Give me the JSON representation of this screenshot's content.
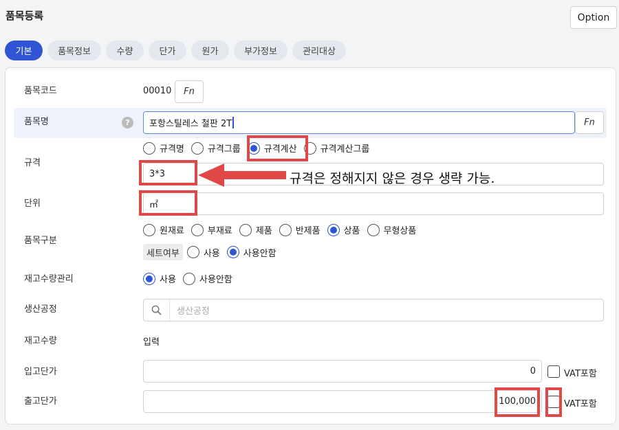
{
  "page": {
    "title": "품목등록",
    "option_label": "Option"
  },
  "tabs": [
    {
      "label": "기본",
      "active": true
    },
    {
      "label": "품목정보"
    },
    {
      "label": "수량"
    },
    {
      "label": "단가"
    },
    {
      "label": "원가"
    },
    {
      "label": "부가정보"
    },
    {
      "label": "관리대상"
    }
  ],
  "fields": {
    "item_code": {
      "label": "품목코드",
      "value": "00010",
      "fn": "Fn"
    },
    "item_name": {
      "label": "품목명",
      "help": "?",
      "value": "포항스틸레스 철판 2T",
      "fn": "Fn"
    },
    "spec": {
      "label": "규격",
      "options": [
        "규격명",
        "규격그룹",
        "규격계산",
        "규격계산그룹"
      ],
      "selected": "규격계산",
      "value": "3*3"
    },
    "unit": {
      "label": "단위",
      "value": "㎡"
    },
    "item_type": {
      "label": "품목구분",
      "options": [
        "원재료",
        "부재료",
        "제품",
        "반제품",
        "상품",
        "무형상품"
      ],
      "selected": "상품",
      "set_label": "세트여부",
      "set_options": [
        "사용",
        "사용안함"
      ],
      "set_selected": "사용안함"
    },
    "stock_mgmt": {
      "label": "재고수량관리",
      "options": [
        "사용",
        "사용안함"
      ],
      "selected": "사용"
    },
    "production": {
      "label": "생산공정",
      "placeholder": "생산공정"
    },
    "stock_qty": {
      "label": "재고수량",
      "value": "입력"
    },
    "purchase_price": {
      "label": "입고단가",
      "value": "0",
      "vat_label": "VAT포함"
    },
    "sales_price": {
      "label": "출고단가",
      "value": "100,000",
      "vat_label": "VAT포함"
    }
  },
  "annotation": "규격은 정해지지 않은 경우 생략 가능.",
  "colors": {
    "accent": "#2f55d4",
    "highlight_red": "#e04848"
  }
}
